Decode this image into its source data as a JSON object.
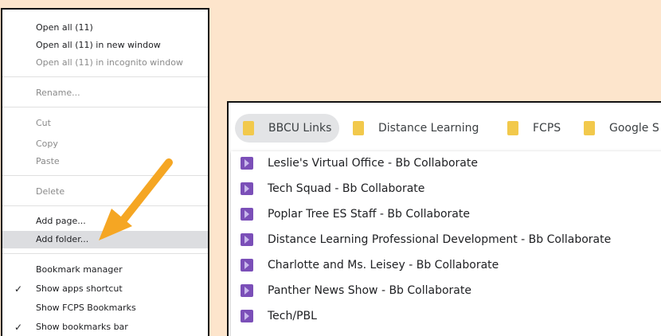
{
  "context_menu": {
    "items": [
      {
        "label": "Open all (11)",
        "disabled": false
      },
      {
        "label": "Open all (11) in new window",
        "disabled": false
      },
      {
        "label": "Open all (11) in incognito window",
        "disabled": true
      },
      {
        "label": "Rename...",
        "disabled": true
      },
      {
        "label": "Cut",
        "disabled": true
      },
      {
        "label": "Copy",
        "disabled": true
      },
      {
        "label": "Paste",
        "disabled": true
      },
      {
        "label": "Delete",
        "disabled": true
      },
      {
        "label": "Add page...",
        "disabled": false
      },
      {
        "label": "Add folder...",
        "disabled": false,
        "highlighted": true
      },
      {
        "label": "Bookmark manager",
        "disabled": false
      },
      {
        "label": "Show apps shortcut",
        "disabled": false,
        "checked": true
      },
      {
        "label": "Show FCPS Bookmarks",
        "disabled": false
      },
      {
        "label": "Show bookmarks bar",
        "disabled": false,
        "checked": true
      }
    ],
    "check_glyph": "✓"
  },
  "arrow": {
    "color": "#F5A623"
  },
  "bookmarks_bar": {
    "folders": [
      {
        "label": "BBCU Links",
        "active": true
      },
      {
        "label": "Distance Learning"
      },
      {
        "label": "FCPS"
      },
      {
        "label": "Google S"
      }
    ]
  },
  "folder_items": [
    {
      "label": "Leslie's Virtual Office - Bb Collaborate"
    },
    {
      "label": "Tech Squad - Bb Collaborate"
    },
    {
      "label": "Poplar Tree ES Staff - Bb Collaborate"
    },
    {
      "label": "Distance Learning Professional Development - Bb Collaborate"
    },
    {
      "label": "Charlotte and Ms. Leisey - Bb Collaborate"
    },
    {
      "label": "Panther News Show - Bb Collaborate"
    },
    {
      "label": "Tech/PBL"
    }
  ],
  "colors": {
    "background": "#FDE5CC",
    "folder": "#F2C94C",
    "collaborate_icon": "#7B4FB8",
    "highlight": "#DCDDE0"
  }
}
